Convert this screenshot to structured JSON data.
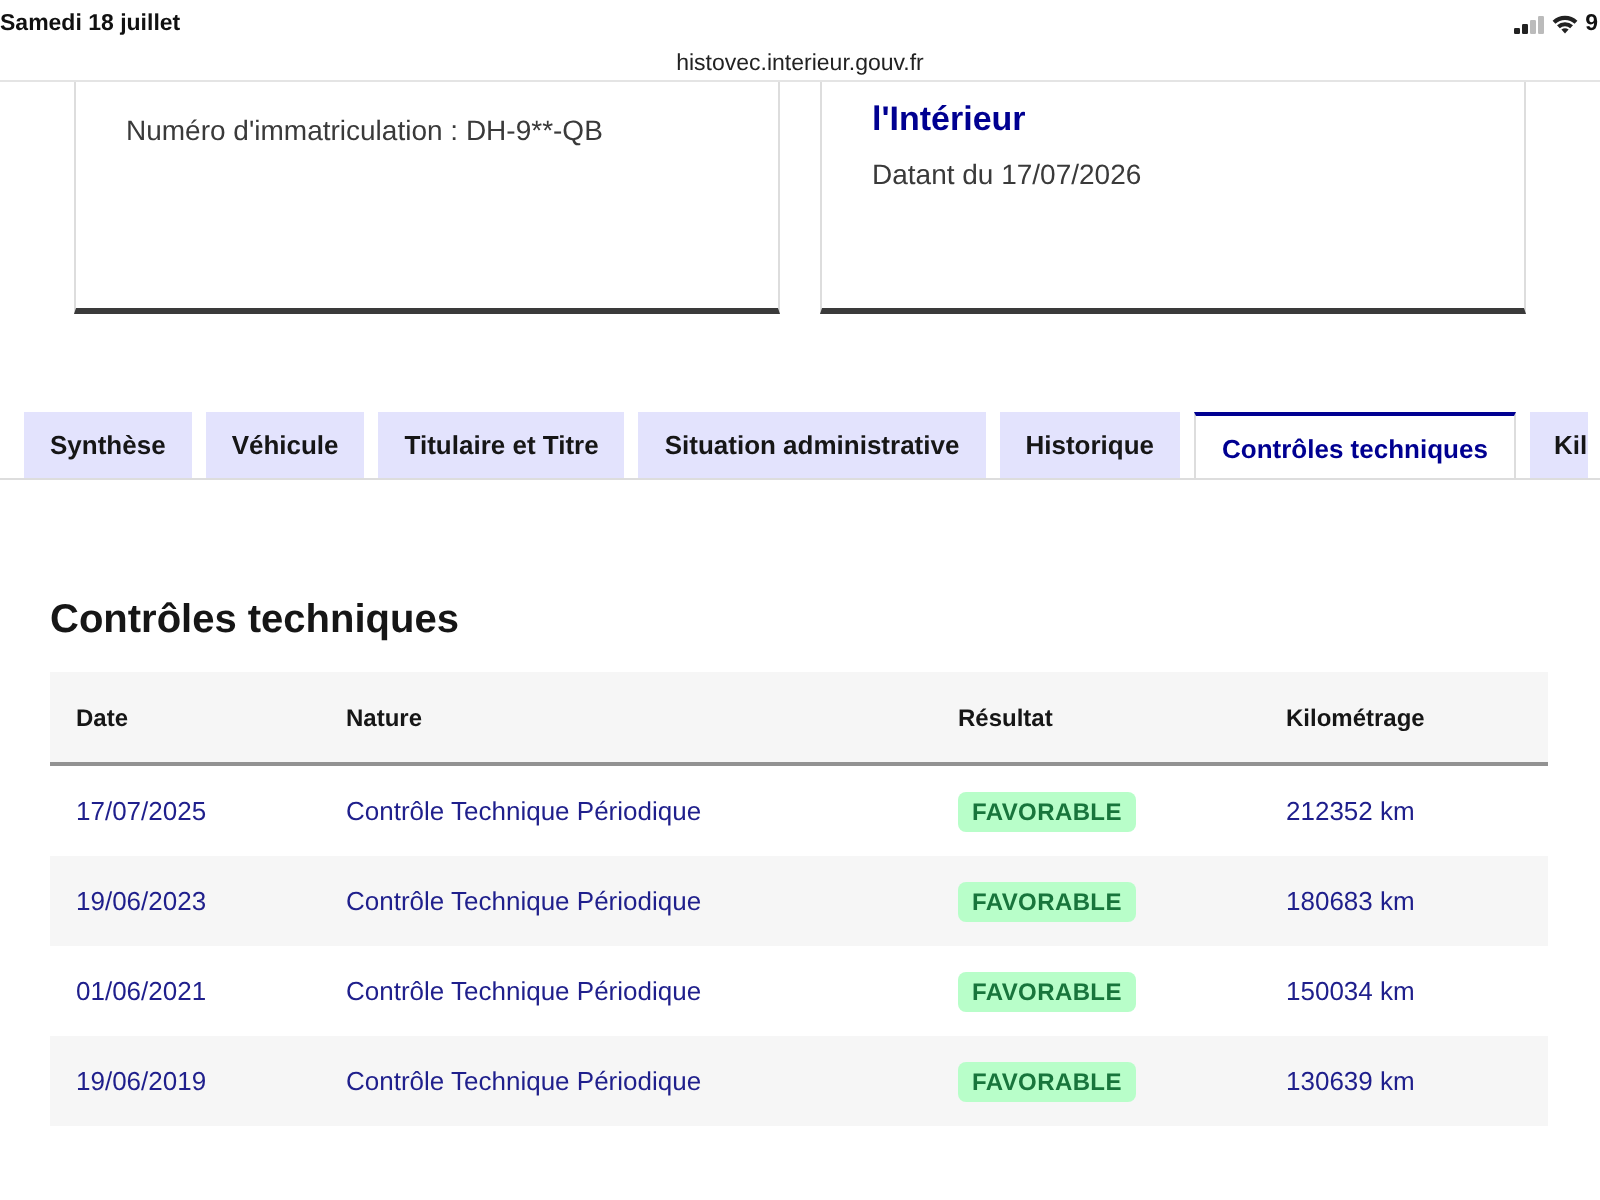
{
  "status_bar": {
    "date": "Samedi 18 juillet",
    "battery": "9"
  },
  "address_bar": {
    "url": "histovec.interieur.gouv.fr"
  },
  "cards": [
    {
      "text": "Numéro d'immatriculation : DH-9**-QB"
    },
    {
      "title": "l'Intérieur",
      "text": "Datant du 17/07/2026"
    }
  ],
  "tabs": [
    {
      "label": "Synthèse",
      "selected": false
    },
    {
      "label": "Véhicule",
      "selected": false
    },
    {
      "label": "Titulaire et Titre",
      "selected": false
    },
    {
      "label": "Situation administrative",
      "selected": false
    },
    {
      "label": "Historique",
      "selected": false
    },
    {
      "label": "Contrôles techniques",
      "selected": true
    },
    {
      "label": "Kil",
      "selected": false
    }
  ],
  "section": {
    "title": "Contrôles techniques",
    "table": {
      "columns": [
        "Date",
        "Nature",
        "Résultat",
        "Kilométrage"
      ],
      "rows": [
        {
          "date": "17/07/2025",
          "nature": "Contrôle Technique Périodique",
          "result": "FAVORABLE",
          "mileage": "212352 km"
        },
        {
          "date": "19/06/2023",
          "nature": "Contrôle Technique Périodique",
          "result": "FAVORABLE",
          "mileage": "180683 km"
        },
        {
          "date": "01/06/2021",
          "nature": "Contrôle Technique Périodique",
          "result": "FAVORABLE",
          "mileage": "150034 km"
        },
        {
          "date": "19/06/2019",
          "nature": "Contrôle Technique Périodique",
          "result": "FAVORABLE",
          "mileage": "130639 km"
        }
      ]
    }
  }
}
